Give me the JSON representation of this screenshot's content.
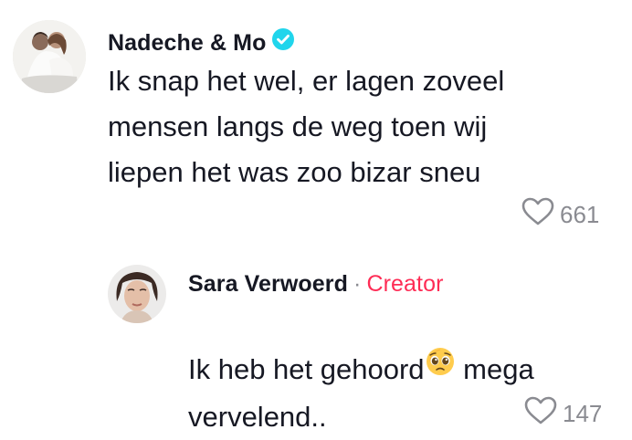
{
  "comments": [
    {
      "username": "Nadeche & Mo",
      "verified": true,
      "text": "Ik snap het wel, er lagen zoveel\nmensen langs de weg toen wij\nliepen het was zoo bizar sneu",
      "likes": "661"
    }
  ],
  "reply": {
    "username": "Sara Verwoerd",
    "separator": "·",
    "badge": "Creator",
    "text_before_emoji": "Ik heb het gehoord",
    "emoji": "pleading-face",
    "text_after_emoji": " mega",
    "text_line2": "vervelend..",
    "likes": "147"
  },
  "colors": {
    "verified_badge": "#20d5ec",
    "creator_badge": "#fe2c55",
    "muted": "#8a8b91"
  },
  "icons": {
    "like": "heart-outline-icon",
    "verified": "verified-check-icon"
  }
}
